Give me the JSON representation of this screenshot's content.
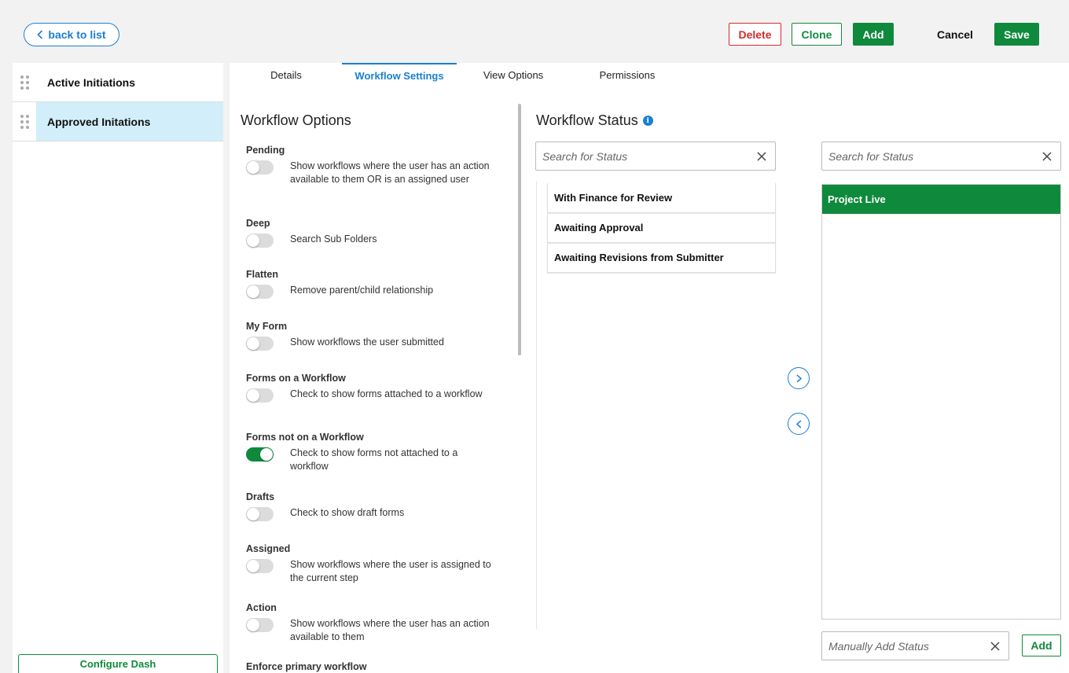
{
  "topbar": {
    "back_label": "back to list",
    "delete_label": "Delete",
    "clone_label": "Clone",
    "add_label": "Add",
    "cancel_label": "Cancel",
    "save_label": "Save"
  },
  "sidebar": {
    "items": [
      {
        "label": "Active Initiations",
        "active": false
      },
      {
        "label": "Approved Initations",
        "active": true
      }
    ],
    "configure_label": "Configure Dash"
  },
  "tabs": [
    {
      "label": "Details"
    },
    {
      "label": "Workflow Settings",
      "active": true
    },
    {
      "label": "View Options"
    },
    {
      "label": "Permissions"
    }
  ],
  "workflow_options": {
    "title": "Workflow Options",
    "options": [
      {
        "title": "Pending",
        "description": "Show workflows where the user has an action available to them OR is an assigned user",
        "on": false
      },
      {
        "title": "Deep",
        "description": "Search Sub Folders",
        "on": false
      },
      {
        "title": "Flatten",
        "description": "Remove parent/child relationship",
        "on": false
      },
      {
        "title": "My Form",
        "description": "Show workflows the user submitted",
        "on": false
      },
      {
        "title": "Forms on a Workflow",
        "description": "Check to show forms attached to a workflow",
        "on": false
      },
      {
        "title": "Forms not on a Workflow",
        "description": "Check to show forms not attached to a workflow",
        "on": true
      },
      {
        "title": "Drafts",
        "description": "Check to show draft forms",
        "on": false
      },
      {
        "title": "Assigned",
        "description": "Show workflows where the user is assigned to the current step",
        "on": false
      },
      {
        "title": "Action",
        "description": "Show workflows where the user has an action available to them",
        "on": false
      },
      {
        "title": "Enforce primary workflow",
        "description": "",
        "on": false
      }
    ]
  },
  "workflow_status": {
    "title": "Workflow Status",
    "info_icon": "i",
    "available_search_placeholder": "Search for Status",
    "selected_search_placeholder": "Search for Status",
    "available": [
      "With Finance for Review",
      "Awaiting Approval",
      "Awaiting Revisions from Submitter"
    ],
    "selected": [
      "Project Live"
    ],
    "manual_placeholder": "Manually Add Status",
    "manual_add_label": "Add"
  },
  "colors": {
    "accent_blue": "#1a7fd1",
    "green": "#0f8a3c",
    "red": "#d62a2a",
    "active_bg": "#d2eefa"
  }
}
